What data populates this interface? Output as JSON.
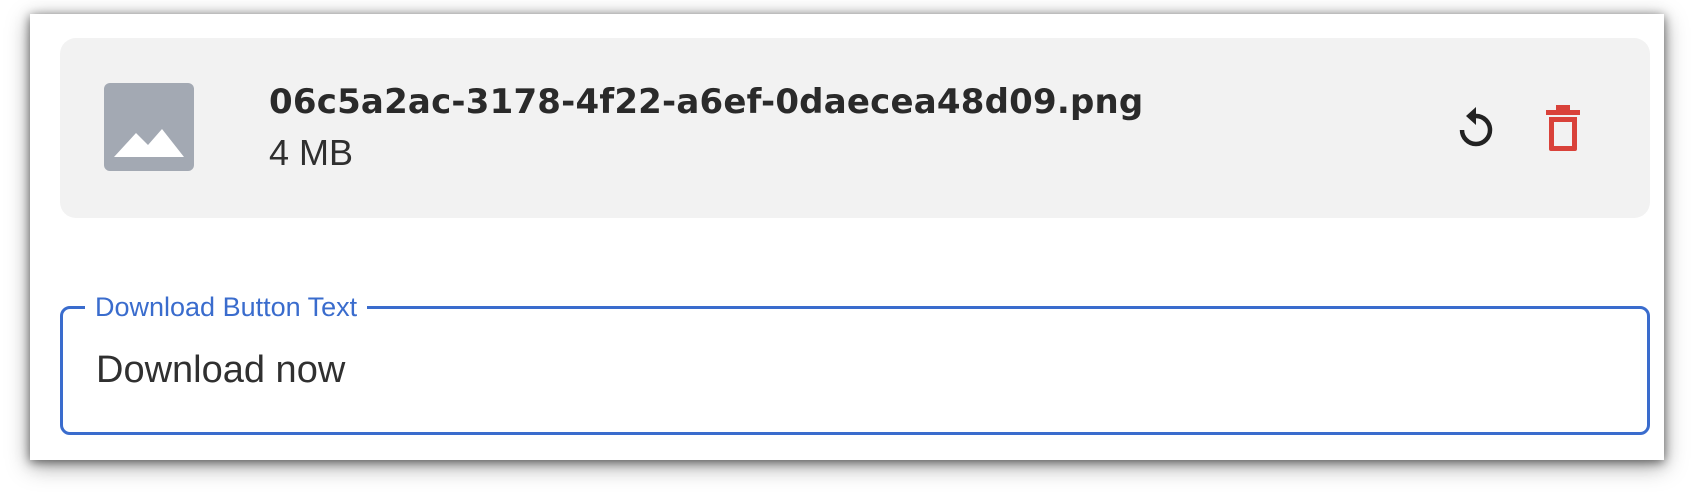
{
  "file": {
    "name": "06c5a2ac-3178-4f22-a6ef-0daecea48d09.png",
    "size": "4 MB",
    "thumbnail_icon": "image-placeholder-icon",
    "actions": {
      "reset_icon": "rotate-ccw-icon",
      "delete_icon": "trash-icon"
    }
  },
  "download_field": {
    "label": "Download Button Text",
    "value": "Download now"
  },
  "colors": {
    "accent": "#3a6ccd",
    "danger": "#d9423a",
    "card_bg": "#f2f2f2",
    "thumb_bg": "#a3a9b3"
  }
}
